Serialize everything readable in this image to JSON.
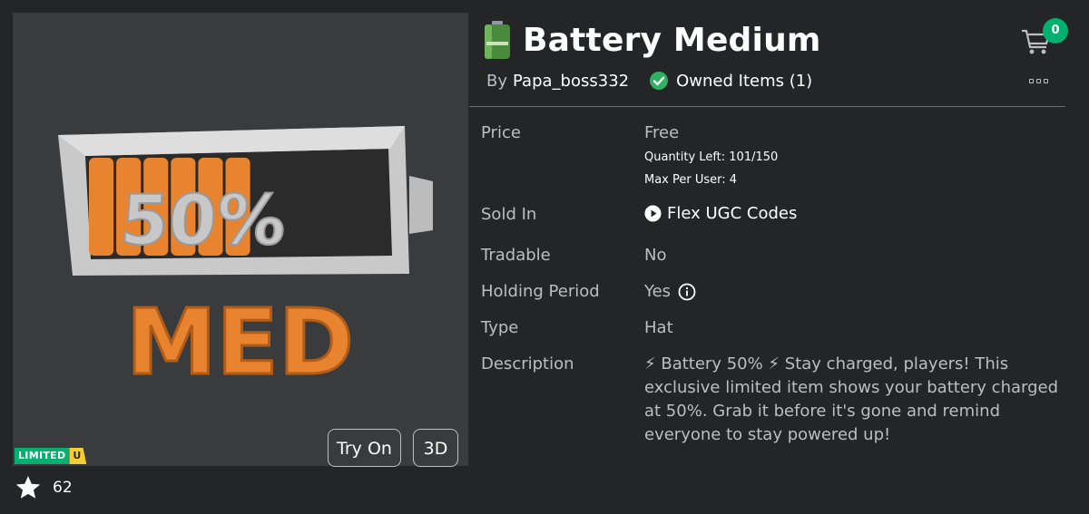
{
  "item": {
    "title": "Battery Medium",
    "by_label": "By",
    "creator": "Papa_boss332",
    "owned_label": "Owned Items (1)",
    "cart_count": "0",
    "favorites": "62",
    "limited_label": "LIMITED",
    "limited_u": "U",
    "art": {
      "percent_text": "50%",
      "word_text": "MED",
      "charge_level": 0.5
    }
  },
  "thumbnail": {
    "try_on_label": "Try On",
    "view_3d_label": "3D"
  },
  "details": {
    "price_label": "Price",
    "price_value": "Free",
    "quantity_left": "Quantity Left: 101/150",
    "max_per_user": "Max Per User: 4",
    "sold_in_label": "Sold In",
    "sold_in_value": "Flex UGC Codes",
    "tradable_label": "Tradable",
    "tradable_value": "No",
    "holding_label": "Holding Period",
    "holding_value": "Yes",
    "type_label": "Type",
    "type_value": "Hat",
    "description_label": "Description",
    "description": "⚡ Battery 50% ⚡ Stay charged, players! This exclusive limited item shows your battery charged at 50%. Grab it before it's gone and remind everyone to stay powered up!"
  },
  "colors": {
    "background": "#232527",
    "panel": "#393b3d",
    "accent_green": "#00b06f",
    "limited_yellow": "#f5cd30",
    "battery_orange": "#e8832f",
    "battery_gray": "#c8c8c8"
  }
}
